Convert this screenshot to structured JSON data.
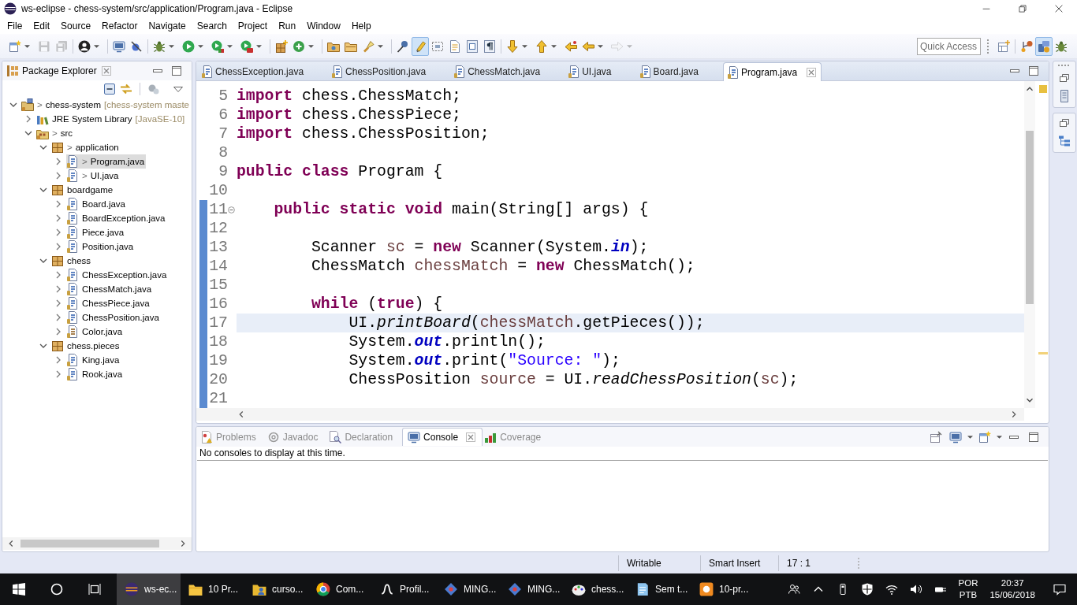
{
  "window": {
    "title": "ws-eclipse - chess-system/src/application/Program.java - Eclipse"
  },
  "menu": [
    "File",
    "Edit",
    "Source",
    "Refactor",
    "Navigate",
    "Search",
    "Project",
    "Run",
    "Window",
    "Help"
  ],
  "toolbar": {
    "groups": [
      {
        "buttons": [
          {
            "menu": true,
            "disabled": false,
            "pressed": false
          },
          {
            "menu": false,
            "disabled": true,
            "pressed": false
          },
          {
            "menu": false,
            "disabled": true,
            "pressed": false
          }
        ]
      },
      {
        "buttons": [
          {
            "menu": true,
            "disabled": false,
            "pressed": false
          }
        ]
      },
      {
        "buttons": [
          {
            "menu": false,
            "disabled": false,
            "pressed": false
          },
          {
            "menu": false,
            "disabled": false,
            "pressed": false
          }
        ]
      },
      {
        "buttons": [
          {
            "menu": true,
            "disabled": false,
            "pressed": false
          },
          {
            "menu": true,
            "disabled": false,
            "pressed": false
          },
          {
            "menu": true,
            "disabled": false,
            "pressed": false
          },
          {
            "menu": true,
            "disabled": false,
            "pressed": false
          }
        ]
      },
      {
        "buttons": [
          {
            "menu": false,
            "disabled": false,
            "pressed": false
          },
          {
            "menu": true,
            "disabled": false,
            "pressed": false
          }
        ]
      },
      {
        "buttons": [
          {
            "menu": false,
            "disabled": false,
            "pressed": false
          },
          {
            "menu": false,
            "disabled": false,
            "pressed": false
          },
          {
            "menu": true,
            "disabled": false,
            "pressed": false
          }
        ]
      },
      {
        "buttons": [
          {
            "menu": false,
            "disabled": false,
            "pressed": false
          },
          {
            "menu": false,
            "disabled": false,
            "pressed": true
          },
          {
            "menu": false,
            "disabled": false,
            "pressed": false
          },
          {
            "menu": false,
            "disabled": false,
            "pressed": false
          },
          {
            "menu": false,
            "disabled": false,
            "pressed": false
          },
          {
            "menu": false,
            "disabled": false,
            "pressed": false
          }
        ]
      },
      {
        "buttons": [
          {
            "menu": true,
            "disabled": false,
            "pressed": false
          },
          {
            "menu": true,
            "disabled": false,
            "pressed": false
          },
          {
            "menu": false,
            "disabled": false,
            "pressed": false
          },
          {
            "menu": true,
            "disabled": false,
            "pressed": false
          },
          {
            "menu": true,
            "disabled": true,
            "pressed": false
          }
        ]
      }
    ],
    "quick_access": {
      "placeholder": "Quick Access"
    },
    "perspectives": [
      {
        "selected": false
      },
      {
        "selected": true
      },
      {
        "selected": false
      }
    ]
  },
  "package_explorer": {
    "title": "Package Explorer",
    "tree": [
      {
        "label": "chess-system",
        "prefix": ">",
        "decoration": "[chess-system maste",
        "kind": "project",
        "expanded": true,
        "selected": false,
        "children": [
          {
            "label": "JRE System Library",
            "decoration": "[JavaSE-10]",
            "kind": "library",
            "expanded": false,
            "selected": false
          },
          {
            "label": "src",
            "prefix": ">",
            "kind": "source-folder",
            "expanded": true,
            "selected": false,
            "children": [
              {
                "label": "application",
                "prefix": ">",
                "kind": "package",
                "expanded": true,
                "selected": false,
                "children": [
                  {
                    "label": "Program.java",
                    "prefix": ">",
                    "kind": "java-file",
                    "expanded": false,
                    "selected": true
                  },
                  {
                    "label": "UI.java",
                    "prefix": ">",
                    "kind": "java-file",
                    "expanded": false,
                    "selected": false
                  }
                ]
              },
              {
                "label": "boardgame",
                "kind": "package",
                "expanded": true,
                "selected": false,
                "children": [
                  {
                    "label": "Board.java",
                    "kind": "java-file",
                    "expanded": false,
                    "selected": false
                  },
                  {
                    "label": "BoardException.java",
                    "kind": "java-file",
                    "expanded": false,
                    "selected": false
                  },
                  {
                    "label": "Piece.java",
                    "kind": "java-file",
                    "expanded": false,
                    "selected": false
                  },
                  {
                    "label": "Position.java",
                    "kind": "java-file",
                    "expanded": false,
                    "selected": false
                  }
                ]
              },
              {
                "label": "chess",
                "kind": "package",
                "expanded": true,
                "selected": false,
                "children": [
                  {
                    "label": "ChessException.java",
                    "kind": "java-file",
                    "expanded": false,
                    "selected": false
                  },
                  {
                    "label": "ChessMatch.java",
                    "kind": "java-file",
                    "expanded": false,
                    "selected": false
                  },
                  {
                    "label": "ChessPiece.java",
                    "kind": "java-file",
                    "expanded": false,
                    "selected": false
                  },
                  {
                    "label": "ChessPosition.java",
                    "kind": "java-file",
                    "expanded": false,
                    "selected": false
                  },
                  {
                    "label": "Color.java",
                    "kind": "enum-file",
                    "expanded": false,
                    "selected": false
                  }
                ]
              },
              {
                "label": "chess.pieces",
                "kind": "package",
                "expanded": true,
                "selected": false,
                "children": [
                  {
                    "label": "King.java",
                    "kind": "java-file",
                    "expanded": false,
                    "selected": false
                  },
                  {
                    "label": "Rook.java",
                    "kind": "java-file",
                    "expanded": false,
                    "selected": false
                  }
                ]
              }
            ]
          }
        ]
      }
    ]
  },
  "editor": {
    "tabs": [
      {
        "label": "ChessException.java",
        "selected": false
      },
      {
        "label": "ChessPosition.java",
        "selected": false
      },
      {
        "label": "ChessMatch.java",
        "selected": false
      },
      {
        "label": "UI.java",
        "selected": false
      },
      {
        "label": "Board.java",
        "selected": false
      },
      {
        "label": "Program.java",
        "selected": true
      }
    ],
    "lines": [
      {
        "number": "5",
        "current": false,
        "fold": false,
        "in_range": false,
        "tokens": [
          {
            "text": "import",
            "kind": "keyword"
          },
          {
            "text": " chess.ChessMatch;",
            "kind": "plain"
          }
        ]
      },
      {
        "number": "6",
        "current": false,
        "fold": false,
        "in_range": false,
        "tokens": [
          {
            "text": "import",
            "kind": "keyword"
          },
          {
            "text": " chess.ChessPiece;",
            "kind": "plain"
          }
        ]
      },
      {
        "number": "7",
        "current": false,
        "fold": false,
        "in_range": false,
        "tokens": [
          {
            "text": "import",
            "kind": "keyword"
          },
          {
            "text": " chess.ChessPosition;",
            "kind": "plain"
          }
        ]
      },
      {
        "number": "8",
        "current": false,
        "fold": false,
        "in_range": false
      },
      {
        "number": "9",
        "current": false,
        "fold": false,
        "in_range": false,
        "tokens": [
          {
            "text": "public class",
            "kind": "keyword"
          },
          {
            "text": " Program {",
            "kind": "plain"
          }
        ]
      },
      {
        "number": "10",
        "current": false,
        "fold": false,
        "in_range": false
      },
      {
        "number": "11",
        "current": false,
        "fold": true,
        "in_range": true,
        "tokens": [
          {
            "text": "    public static void",
            "kind": "keyword"
          },
          {
            "text": " main(String[] args) {",
            "kind": "plain"
          }
        ]
      },
      {
        "number": "12",
        "current": false,
        "fold": false,
        "in_range": true
      },
      {
        "number": "13",
        "current": false,
        "fold": false,
        "in_range": true,
        "tokens": [
          {
            "text": "        Scanner ",
            "kind": "plain"
          },
          {
            "text": "sc",
            "kind": "local"
          },
          {
            "text": " = ",
            "kind": "plain"
          },
          {
            "text": "new",
            "kind": "keyword"
          },
          {
            "text": " Scanner(System.",
            "kind": "plain"
          },
          {
            "text": "in",
            "kind": "static-field"
          },
          {
            "text": ");",
            "kind": "plain"
          }
        ]
      },
      {
        "number": "14",
        "current": false,
        "fold": false,
        "in_range": true,
        "tokens": [
          {
            "text": "        ChessMatch ",
            "kind": "plain"
          },
          {
            "text": "chessMatch",
            "kind": "local"
          },
          {
            "text": " = ",
            "kind": "plain"
          },
          {
            "text": "new",
            "kind": "keyword"
          },
          {
            "text": " ChessMatch();",
            "kind": "plain"
          }
        ]
      },
      {
        "number": "15",
        "current": false,
        "fold": false,
        "in_range": true
      },
      {
        "number": "16",
        "current": false,
        "fold": false,
        "in_range": true,
        "tokens": [
          {
            "text": "        while",
            "kind": "keyword"
          },
          {
            "text": " (",
            "kind": "plain"
          },
          {
            "text": "true",
            "kind": "keyword"
          },
          {
            "text": ") {",
            "kind": "plain"
          }
        ]
      },
      {
        "number": "17",
        "current": true,
        "fold": false,
        "in_range": true,
        "tokens": [
          {
            "text": "            UI.",
            "kind": "plain"
          },
          {
            "text": "printBoard",
            "kind": "static-method"
          },
          {
            "text": "(",
            "kind": "plain"
          },
          {
            "text": "chessMatch",
            "kind": "local"
          },
          {
            "text": ".getPieces());",
            "kind": "plain"
          }
        ]
      },
      {
        "number": "18",
        "current": false,
        "fold": false,
        "in_range": true,
        "tokens": [
          {
            "text": "            System.",
            "kind": "plain"
          },
          {
            "text": "out",
            "kind": "static-field"
          },
          {
            "text": ".println();",
            "kind": "plain"
          }
        ]
      },
      {
        "number": "19",
        "current": false,
        "fold": false,
        "in_range": true,
        "tokens": [
          {
            "text": "            System.",
            "kind": "plain"
          },
          {
            "text": "out",
            "kind": "static-field"
          },
          {
            "text": ".print(",
            "kind": "plain"
          },
          {
            "text": "\"Source: \"",
            "kind": "string"
          },
          {
            "text": ");",
            "kind": "plain"
          }
        ]
      },
      {
        "number": "20",
        "current": false,
        "fold": false,
        "in_range": true,
        "tokens": [
          {
            "text": "            ChessPosition ",
            "kind": "plain"
          },
          {
            "text": "source",
            "kind": "local"
          },
          {
            "text": " = UI.",
            "kind": "plain"
          },
          {
            "text": "readChessPosition",
            "kind": "static-method"
          },
          {
            "text": "(",
            "kind": "plain"
          },
          {
            "text": "sc",
            "kind": "local"
          },
          {
            "text": ");",
            "kind": "plain"
          }
        ]
      },
      {
        "number": "21",
        "current": false,
        "fold": false,
        "in_range": true
      }
    ]
  },
  "console": {
    "tabs": [
      {
        "label": "Problems",
        "selected": false
      },
      {
        "label": "Javadoc",
        "selected": false
      },
      {
        "label": "Declaration",
        "selected": false
      },
      {
        "label": "Console",
        "selected": true
      },
      {
        "label": "Coverage",
        "selected": false
      }
    ],
    "message": "No consoles to display at this time."
  },
  "status_bar": {
    "write_mode": "Writable",
    "insert_mode": "Smart Insert",
    "cursor_position": "17 : 1"
  },
  "taskbar": {
    "apps": [
      {
        "label": "ws-ec...",
        "kind": "ide",
        "selected": true
      },
      {
        "label": "10 Pr...",
        "kind": "folder",
        "selected": false
      },
      {
        "label": "curso...",
        "kind": "user-folder",
        "selected": false
      },
      {
        "label": "Com...",
        "kind": "browser",
        "selected": false
      },
      {
        "label": "Profil...",
        "kind": "profiler",
        "selected": false
      },
      {
        "label": "MING...",
        "kind": "git-shell",
        "selected": false
      },
      {
        "label": "MING...",
        "kind": "git-shell",
        "selected": false
      },
      {
        "label": "chess...",
        "kind": "paint",
        "selected": false
      },
      {
        "label": "Sem t...",
        "kind": "notepad",
        "selected": false
      },
      {
        "label": "10-pr...",
        "kind": "slides",
        "selected": false
      }
    ],
    "input_language": {
      "language": "POR",
      "layout": "PTB"
    },
    "clock": {
      "time": "20:37",
      "date": "15/06/2018"
    }
  }
}
